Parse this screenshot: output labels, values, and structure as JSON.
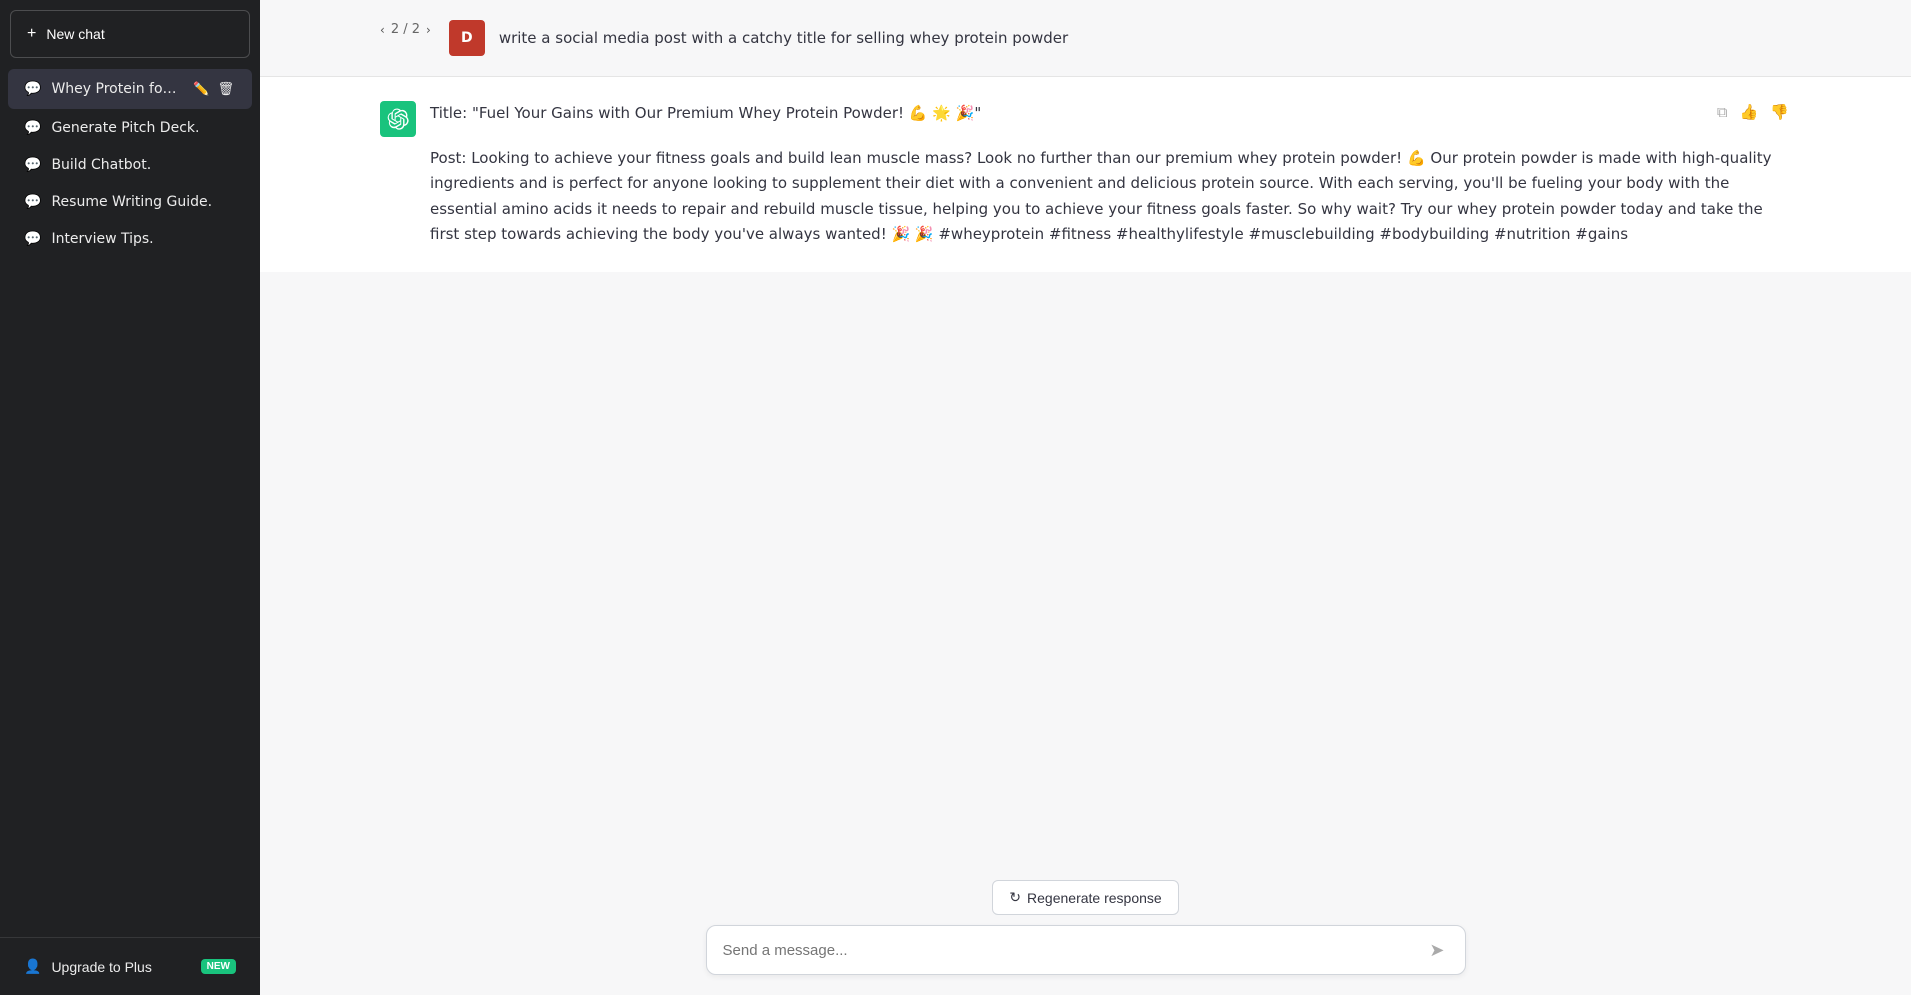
{
  "sidebar": {
    "new_chat_label": "New chat",
    "items": [
      {
        "id": "whey-protein",
        "label": "Whey Protein for Gains.",
        "active": true
      },
      {
        "id": "generate-pitch-deck",
        "label": "Generate Pitch Deck.",
        "active": false
      },
      {
        "id": "build-chatbot",
        "label": "Build Chatbot.",
        "active": false
      },
      {
        "id": "resume-writing-guide",
        "label": "Resume Writing Guide.",
        "active": false
      },
      {
        "id": "interview-tips",
        "label": "Interview Tips.",
        "active": false
      }
    ],
    "footer": {
      "upgrade_label": "Upgrade to Plus",
      "badge_label": "NEW"
    }
  },
  "chat": {
    "pagination": {
      "current": 2,
      "total": 2,
      "prev_arrow": "‹",
      "next_arrow": "›"
    },
    "user_avatar_label": "D",
    "user_message": "write a social media post with a catchy title for selling whey protein powder",
    "assistant_title": "Title: \"Fuel Your Gains with Our Premium Whey Protein Powder! 💪 🌟 🎉\"",
    "assistant_post": "Post: Looking to achieve your fitness goals and build lean muscle mass? Look no further than our premium whey protein powder! 💪 Our protein powder is made with high-quality ingredients and is perfect for anyone looking to supplement their diet with a convenient and delicious protein source. With each serving, you'll be fueling your body with the essential amino acids it needs to repair and rebuild muscle tissue, helping you to achieve your fitness goals faster. So why wait? Try our whey protein powder today and take the first step towards achieving the body you've always wanted! 🎉 🎉 #wheyprotein #fitness #healthylifestyle #musclebuilding #bodybuilding #nutrition #gains",
    "regenerate_label": "Regenerate response",
    "input_placeholder": "Send a message..."
  },
  "icons": {
    "plus": "+",
    "chat": "💬",
    "user": "👤",
    "copy": "⧉",
    "thumbs_up": "👍",
    "thumbs_down": "👎",
    "send": "➤",
    "regenerate": "↻"
  }
}
